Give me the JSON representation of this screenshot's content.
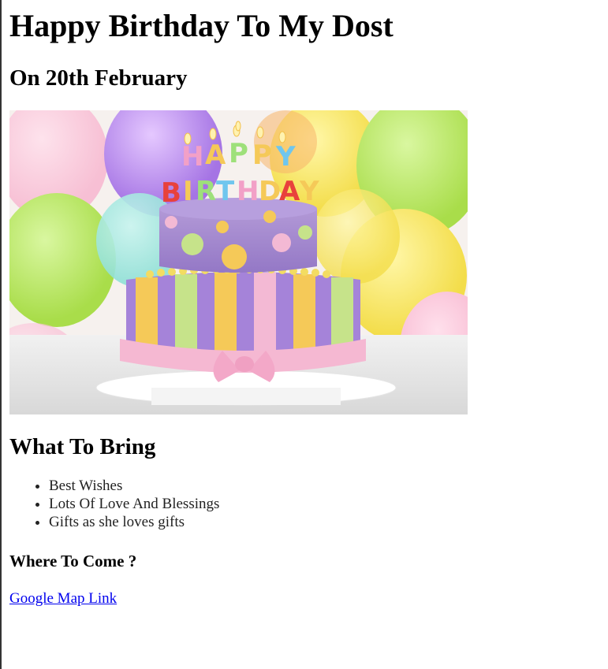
{
  "page": {
    "title": "Happy Birthday To My Dost",
    "subtitle": "On 20th February"
  },
  "image": {
    "description_icon": "birthday-cake-image",
    "cake_text_top": "HAPPY",
    "cake_text_bottom": "BIRTHDAY"
  },
  "bring": {
    "heading": "What To Bring",
    "items": [
      "Best Wishes",
      "Lots Of Love And Blessings",
      "Gifts as she loves gifts"
    ]
  },
  "where": {
    "heading": "Where To Come ?",
    "link_label": "Google Map Link"
  },
  "colors": {
    "link": "#0000ee",
    "text": "#222222"
  }
}
